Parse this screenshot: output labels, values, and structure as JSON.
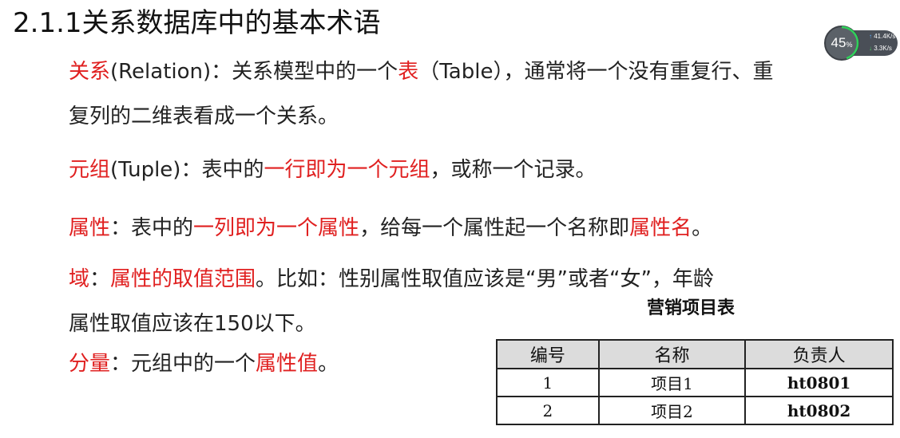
{
  "title": "2.1.1关系数据库中的基本术语",
  "widget": {
    "percent": "45",
    "percent_unit": "%",
    "upload_speed": "41.4",
    "upload_unit": "K/s",
    "download_speed": "3.3",
    "download_unit": "K/s"
  },
  "relation": {
    "term": "关系",
    "term_en": "(Relation)：",
    "text_a": "关系模型中的一个",
    "highlight": "表",
    "text_b": "（Table），通常将一个没有重复行、重",
    "line2": "复列的二维表看成一个关系。"
  },
  "tuple": {
    "term": "元组",
    "term_en": "(Tuple)：",
    "text_a": "表中的",
    "highlight": "一行即为一个元组",
    "text_b": "，或称一个记录。"
  },
  "attribute": {
    "term": "属性",
    "sep": "：",
    "text_a": "表中的",
    "highlight": "一列即为一个属性",
    "text_b": "，给每一个属性起一个名称即",
    "highlight2": "属性名",
    "text_c": "。"
  },
  "domain": {
    "term": "域",
    "sep": "：",
    "highlight": "属性的取值范围",
    "text_a": "。比如：性别属性取值应该是“男”或者“女”，年龄",
    "line2": "属性取值应该在150以下。"
  },
  "component": {
    "term": "分量",
    "sep": "：",
    "text_a": "元组中的一个",
    "highlight": "属性值",
    "text_b": "。"
  },
  "table": {
    "caption": "营销项目表",
    "headers": [
      "编号",
      "名称",
      "负责人"
    ],
    "rows": [
      [
        "1",
        "项目1",
        "ht0801"
      ],
      [
        "2",
        "项目2",
        "ht0802"
      ]
    ]
  }
}
